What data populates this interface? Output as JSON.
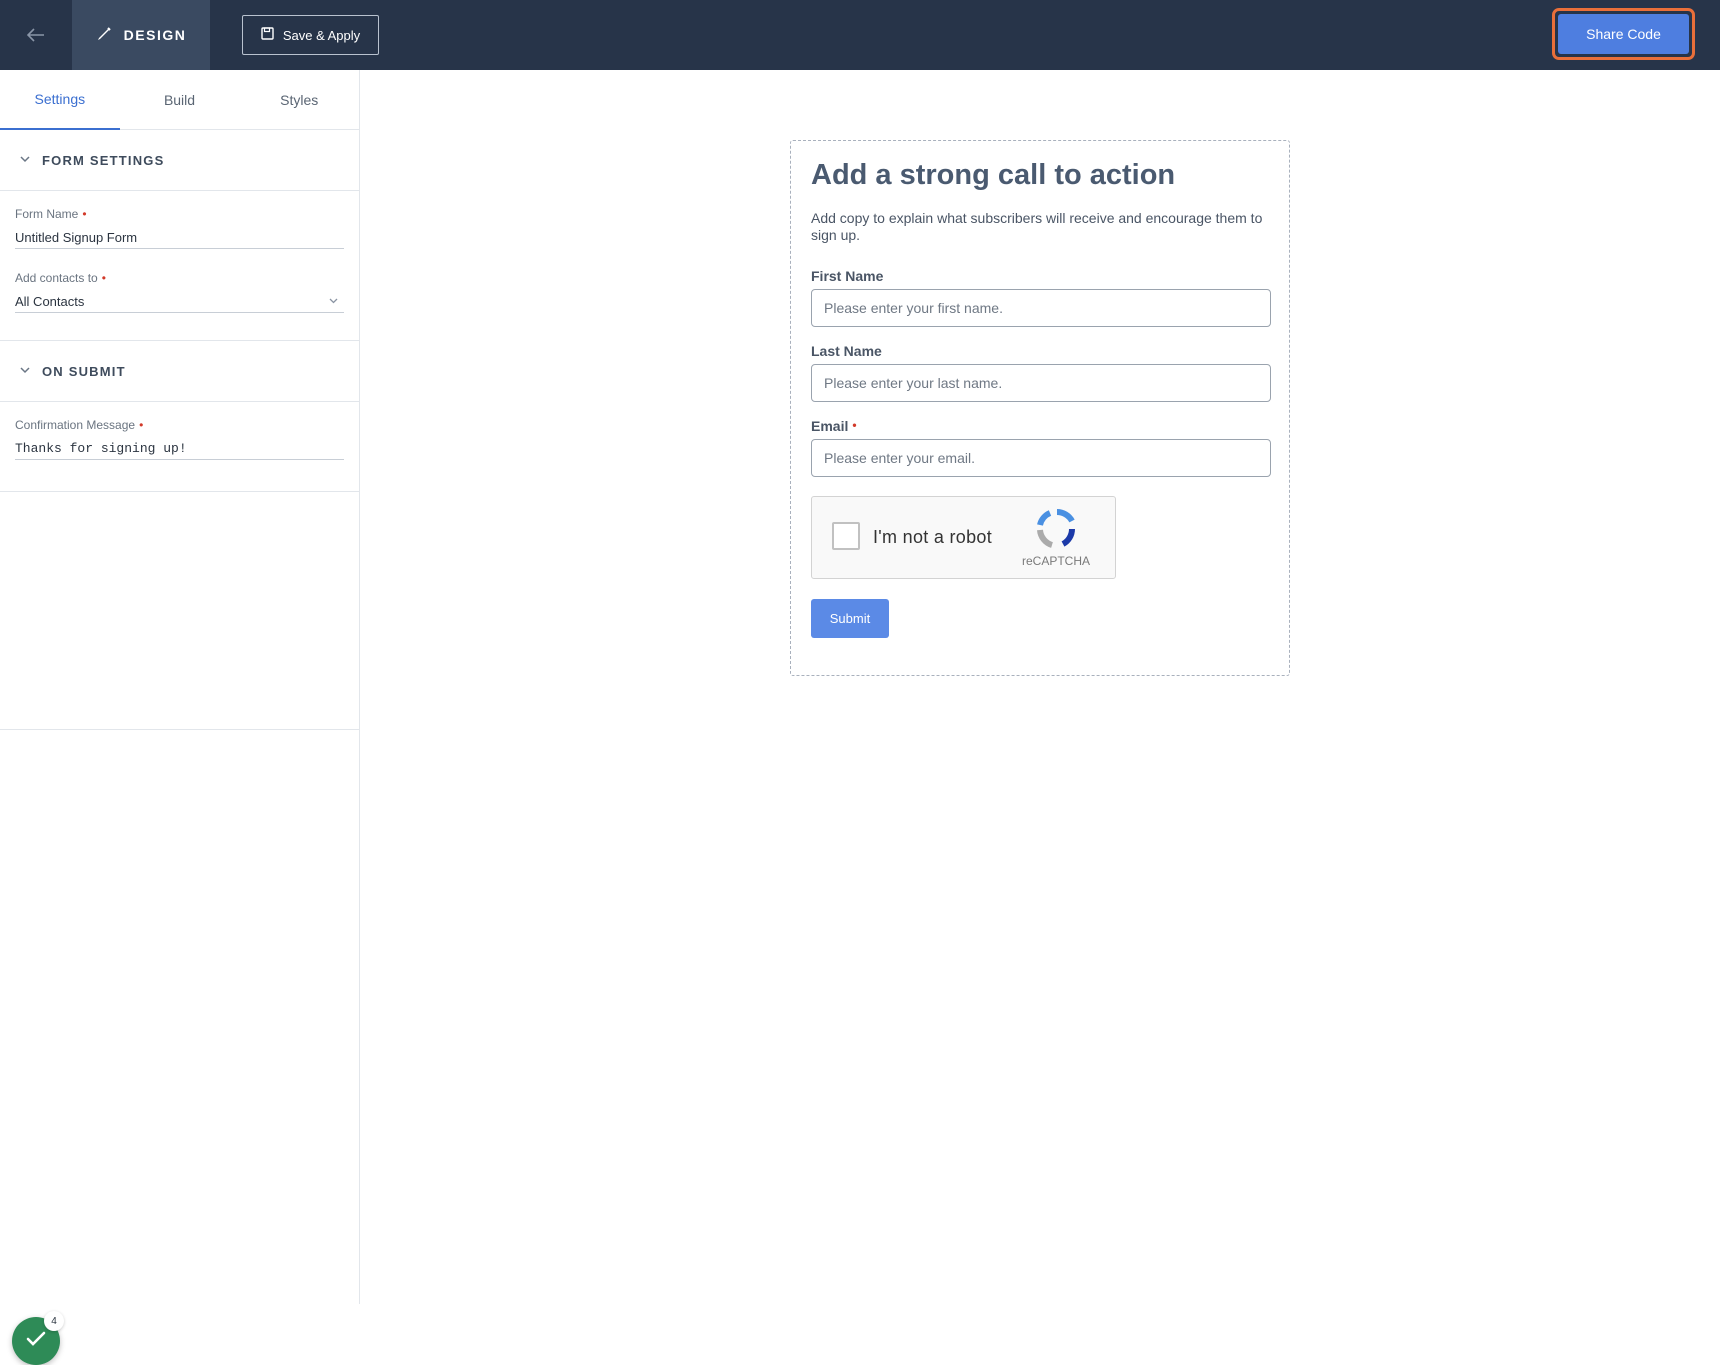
{
  "topbar": {
    "design_label": "DESIGN",
    "save_label": "Save & Apply",
    "share_label": "Share Code"
  },
  "sidebar": {
    "tabs": [
      {
        "label": "Settings",
        "active": true
      },
      {
        "label": "Build",
        "active": false
      },
      {
        "label": "Styles",
        "active": false
      }
    ],
    "form_settings": {
      "title": "FORM SETTINGS",
      "form_name_label": "Form Name",
      "form_name_value": "Untitled Signup Form",
      "add_contacts_label": "Add contacts to",
      "add_contacts_value": "All Contacts"
    },
    "on_submit": {
      "title": "ON SUBMIT",
      "confirmation_label": "Confirmation Message",
      "confirmation_value": "Thanks for signing up!"
    },
    "fab_badge": "4"
  },
  "form_preview": {
    "heading": "Add a strong call to action",
    "copy": "Add copy to explain what subscribers will receive and encourage them to sign up.",
    "first_name_label": "First Name",
    "first_name_placeholder": "Please enter your first name.",
    "last_name_label": "Last Name",
    "last_name_placeholder": "Please enter your last name.",
    "email_label": "Email",
    "email_placeholder": "Please enter your email.",
    "captcha_text": "I'm not a robot",
    "captcha_brand": "reCAPTCHA",
    "submit_label": "Submit"
  },
  "colors": {
    "topbar_bg": "#273449",
    "accent_blue": "#4e7ee0",
    "share_focus_ring": "#e96f3a",
    "required_marker": "#d23a2a",
    "fab_green": "#2e8b57"
  }
}
